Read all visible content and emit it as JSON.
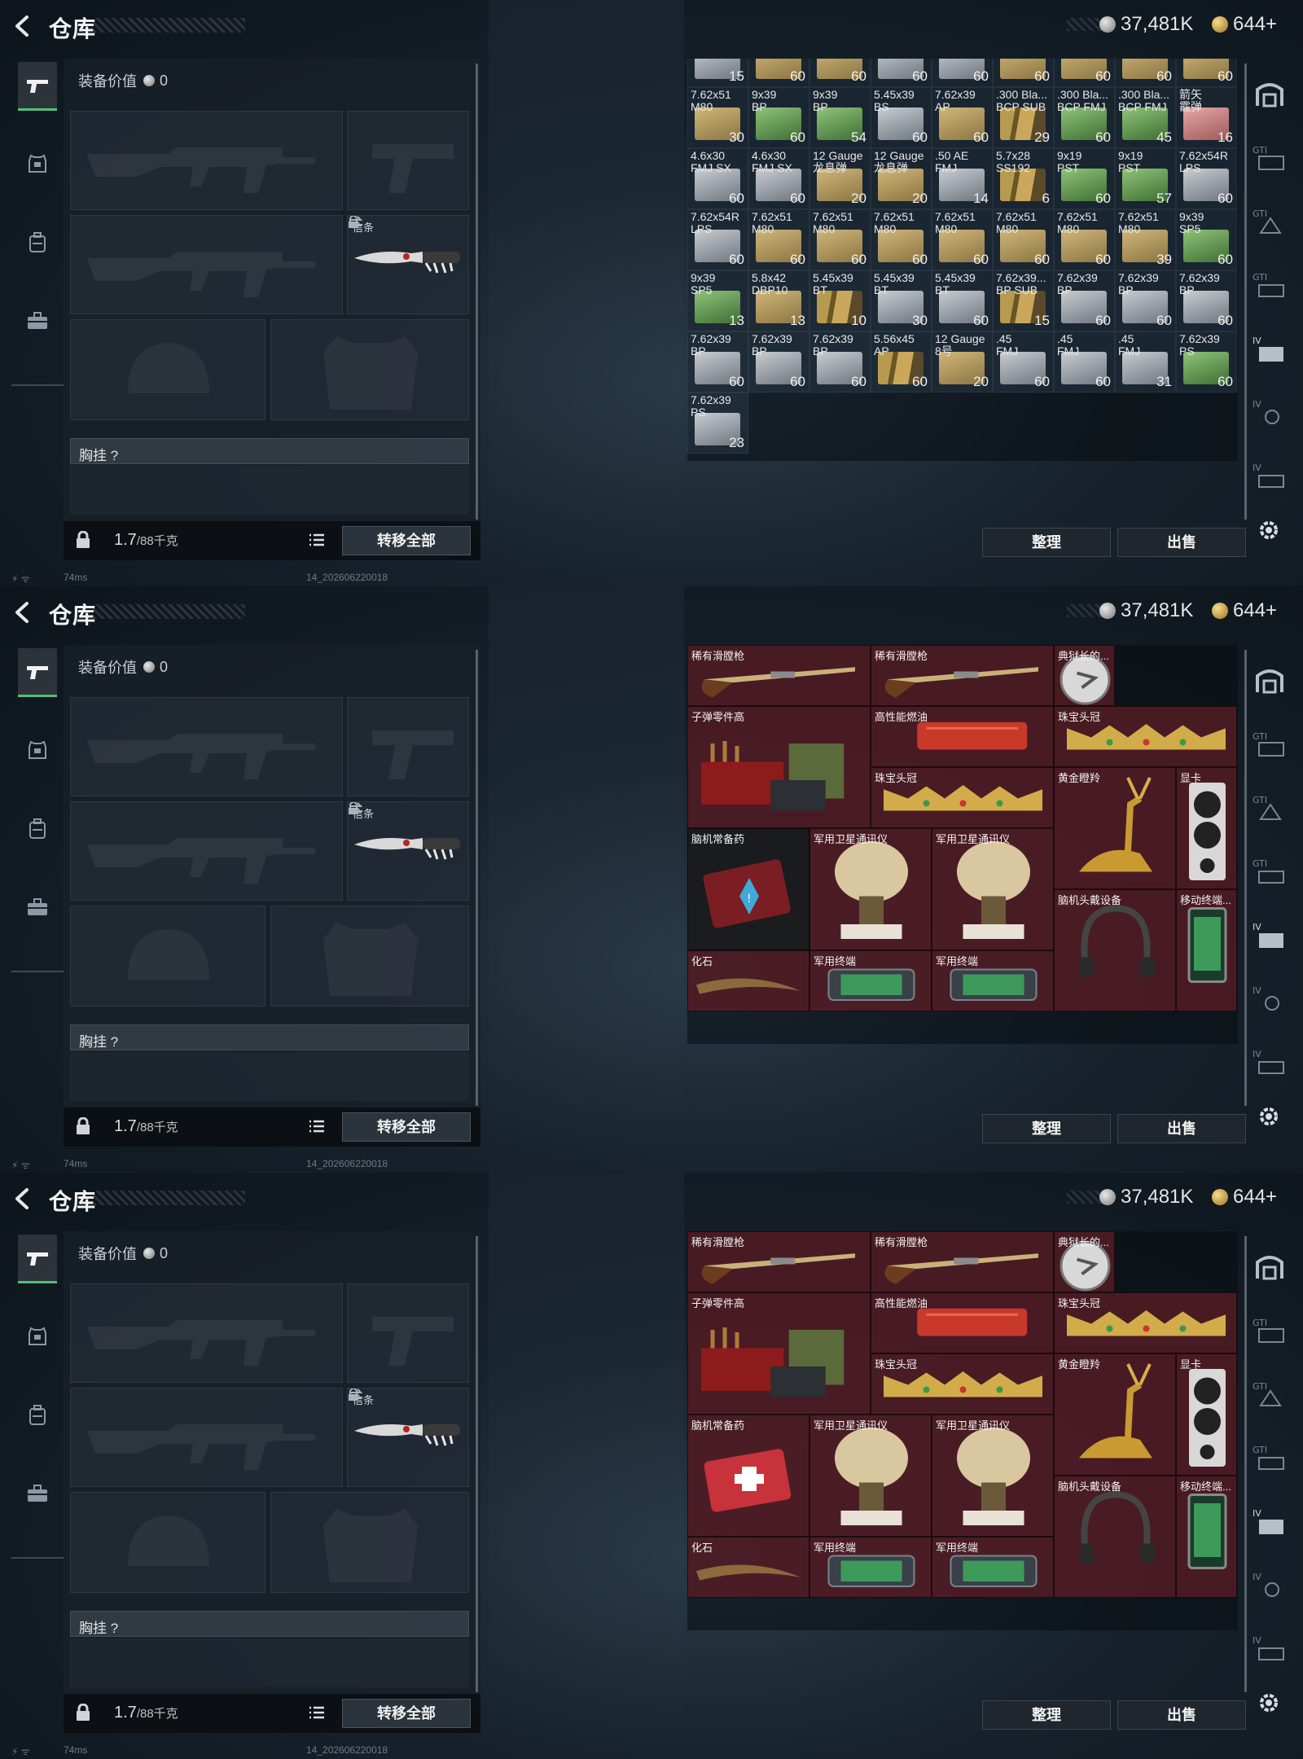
{
  "screens": [
    {
      "title": "仓库",
      "currency_silver": "37,481K",
      "currency_gold": "644+",
      "equip_value_label": "装备价值",
      "equip_value": "0",
      "knife_slot_label": "信条",
      "chest_label": "胸挂 ?",
      "weight_value": "1.7",
      "weight_unit": "/88千克",
      "transfer_all": "转移全部",
      "organize": "整理",
      "sell": "出售",
      "ping": "74ms",
      "build": "14_202606220018"
    },
    {
      "title": "仓库",
      "currency_silver": "37,481K",
      "currency_gold": "644+",
      "equip_value_label": "装备价值",
      "equip_value": "0",
      "knife_slot_label": "信条",
      "chest_label": "胸挂 ?",
      "weight_value": "1.7",
      "weight_unit": "/88千克",
      "transfer_all": "转移全部",
      "organize": "整理",
      "sell": "出售",
      "ping": "74ms",
      "build": "14_202606220018"
    },
    {
      "title": "仓库",
      "currency_silver": "37,481K",
      "currency_gold": "644+",
      "equip_value_label": "装备价值",
      "equip_value": "0",
      "knife_slot_label": "信条",
      "chest_label": "胸挂 ?",
      "weight_value": "1.7",
      "weight_unit": "/88千克",
      "transfer_all": "转移全部",
      "organize": "整理",
      "sell": "出售",
      "ping": "74ms",
      "build": "14_202606220018"
    }
  ],
  "ammo_grid": [
    {
      "name": "",
      "count": "15",
      "color": "grey"
    },
    {
      "name": "",
      "count": "60",
      "color": "tan"
    },
    {
      "name": "",
      "count": "60",
      "color": "tan"
    },
    {
      "name": "",
      "count": "60",
      "color": "grey"
    },
    {
      "name": "",
      "count": "60",
      "color": "grey"
    },
    {
      "name": "",
      "count": "60",
      "color": "tan"
    },
    {
      "name": "",
      "count": "60",
      "color": "tan"
    },
    {
      "name": "",
      "count": "60",
      "color": "tan"
    },
    {
      "name": "",
      "count": "60",
      "color": "tan"
    },
    {
      "name": "7.62x51\nM80",
      "count": "30",
      "color": "tan"
    },
    {
      "name": "9x39\nBP",
      "count": "60",
      "color": "green"
    },
    {
      "name": "9x39\nBP",
      "count": "54",
      "color": "green"
    },
    {
      "name": "5.45x39\nBS",
      "count": "60",
      "color": "grey"
    },
    {
      "name": "7.62x39\nAP",
      "count": "60",
      "color": "tan"
    },
    {
      "name": ".300 Bla...\nBCP SUB",
      "count": "29",
      "color": "bullets"
    },
    {
      "name": ".300 Bla...\nBCP FMJ",
      "count": "60",
      "color": "green"
    },
    {
      "name": ".300 Bla...\nBCP FMJ",
      "count": "45",
      "color": "green"
    },
    {
      "name": "箭矢\n霰弹",
      "count": "16",
      "color": "pink"
    },
    {
      "name": "4.6x30\nFMJ SX",
      "count": "60",
      "color": "grey"
    },
    {
      "name": "4.6x30\nFMJ SX",
      "count": "60",
      "color": "grey"
    },
    {
      "name": "12 Gauge\n龙息弹",
      "count": "20",
      "color": "tan"
    },
    {
      "name": "12 Gauge\n龙息弹",
      "count": "20",
      "color": "tan"
    },
    {
      "name": ".50 AE\nFMJ",
      "count": "14",
      "color": "grey"
    },
    {
      "name": "5.7x28\nSS192",
      "count": "6",
      "color": "bullets"
    },
    {
      "name": "9x19\nPST",
      "count": "60",
      "color": "green"
    },
    {
      "name": "9x19\nPST",
      "count": "57",
      "color": "green"
    },
    {
      "name": "7.62x54R\nLPS",
      "count": "60",
      "color": "grey"
    },
    {
      "name": "7.62x54R\nLPS",
      "count": "60",
      "color": "grey"
    },
    {
      "name": "7.62x51\nM80",
      "count": "60",
      "color": "tan"
    },
    {
      "name": "7.62x51\nM80",
      "count": "60",
      "color": "tan"
    },
    {
      "name": "7.62x51\nM80",
      "count": "60",
      "color": "tan"
    },
    {
      "name": "7.62x51\nM80",
      "count": "60",
      "color": "tan"
    },
    {
      "name": "7.62x51\nM80",
      "count": "60",
      "color": "tan"
    },
    {
      "name": "7.62x51\nM80",
      "count": "60",
      "color": "tan"
    },
    {
      "name": "7.62x51\nM80",
      "count": "39",
      "color": "tan"
    },
    {
      "name": "9x39\nSP5",
      "count": "60",
      "color": "green"
    },
    {
      "name": "9x39\nSP5",
      "count": "13",
      "color": "green"
    },
    {
      "name": "5.8x42\nDBP10",
      "count": "13",
      "color": "tan"
    },
    {
      "name": "5.45x39\nBT",
      "count": "10",
      "color": "bullets"
    },
    {
      "name": "5.45x39\nBT",
      "count": "30",
      "color": "grey"
    },
    {
      "name": "5.45x39\nBT",
      "count": "60",
      "color": "grey"
    },
    {
      "name": "7.62x39...\nBP SUB",
      "count": "15",
      "color": "bullets"
    },
    {
      "name": "7.62x39\nBP",
      "count": "60",
      "color": "grey"
    },
    {
      "name": "7.62x39\nBP",
      "count": "60",
      "color": "grey"
    },
    {
      "name": "7.62x39\nBP",
      "count": "60",
      "color": "grey"
    },
    {
      "name": "7.62x39\nBP",
      "count": "60",
      "color": "grey"
    },
    {
      "name": "7.62x39\nBP",
      "count": "60",
      "color": "grey"
    },
    {
      "name": "7.62x39\nBP",
      "count": "60",
      "color": "grey"
    },
    {
      "name": "5.56x45\nAP",
      "count": "60",
      "color": "bullets"
    },
    {
      "name": "12 Gauge\n8号",
      "count": "20",
      "color": "tan"
    },
    {
      "name": ".45\nFMJ",
      "count": "60",
      "color": "grey"
    },
    {
      "name": ".45\nFMJ",
      "count": "60",
      "color": "grey"
    },
    {
      "name": ".45\nFMJ",
      "count": "31",
      "color": "grey"
    },
    {
      "name": "7.62x39\nPS",
      "count": "60",
      "color": "green"
    },
    {
      "name": "7.62x39\nPS",
      "count": "23",
      "color": "grey"
    }
  ],
  "valuables": [
    {
      "name": "稀有滑膛枪",
      "kind": "musket"
    },
    {
      "name": "稀有滑膛枪",
      "kind": "musket"
    },
    {
      "name": "典狱长的...",
      "kind": "badge"
    },
    {
      "name": "子弹零件高",
      "kind": "parts"
    },
    {
      "name": "高性能燃油",
      "kind": "fuel"
    },
    {
      "name": "珠宝头冠",
      "kind": "crown"
    },
    {
      "name": "珠宝头冠",
      "kind": "crown"
    },
    {
      "name": "黄金瞪羚",
      "kind": "gazelle"
    },
    {
      "name": "显卡",
      "kind": "gpu"
    },
    {
      "name": "脑机常备药",
      "kind": "medkit"
    },
    {
      "name": "军用卫星通讯仪",
      "kind": "satcom"
    },
    {
      "name": "军用卫星通讯仪",
      "kind": "satcom"
    },
    {
      "name": "脑机头戴设备",
      "kind": "headset"
    },
    {
      "name": "移动终端...",
      "kind": "terminal"
    },
    {
      "name": "化石",
      "kind": "fossil"
    },
    {
      "name": "军用终端",
      "kind": "mil-terminal"
    },
    {
      "name": "军用终端",
      "kind": "mil-terminal"
    }
  ],
  "colors": {
    "accent_green": "#4fbf7a",
    "valuable_bg": "#5a1e26"
  }
}
